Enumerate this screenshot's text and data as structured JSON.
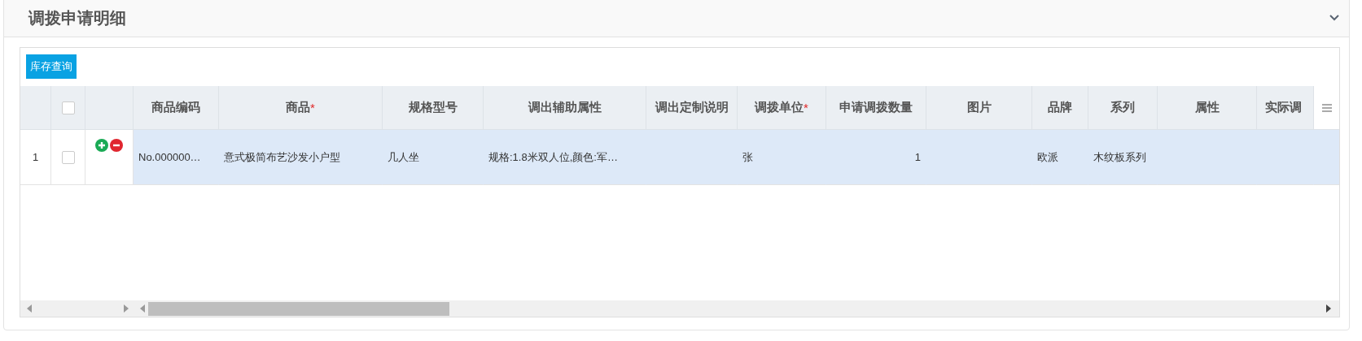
{
  "panel": {
    "title": "调拨申请明细",
    "expanded": true
  },
  "toolbar": {
    "button": "库存查询"
  },
  "table": {
    "header_checked": false,
    "columns": [
      {
        "label": "商品编码"
      },
      {
        "label": "商品",
        "required_mark": "*"
      },
      {
        "label": "规格型号"
      },
      {
        "label": "调出辅助属性"
      },
      {
        "label": "调出定制说明"
      },
      {
        "label": "调拨单位",
        "required_mark": "*"
      },
      {
        "label": "申请调拨数量",
        "numeric": true
      },
      {
        "label": "图片"
      },
      {
        "label": "品牌"
      },
      {
        "label": "系列"
      },
      {
        "label": "属性"
      },
      {
        "label": "实际调"
      }
    ],
    "rows": [
      {
        "number": "1",
        "checked": false,
        "selected": true,
        "cells": [
          "No.000000…",
          "意式极简布艺沙发小户型",
          "几人坐",
          "规格:1.8米双人位,颜色:军…",
          null,
          "张",
          "1",
          null,
          "欧派",
          "木纹板系列",
          null,
          null
        ]
      }
    ]
  }
}
